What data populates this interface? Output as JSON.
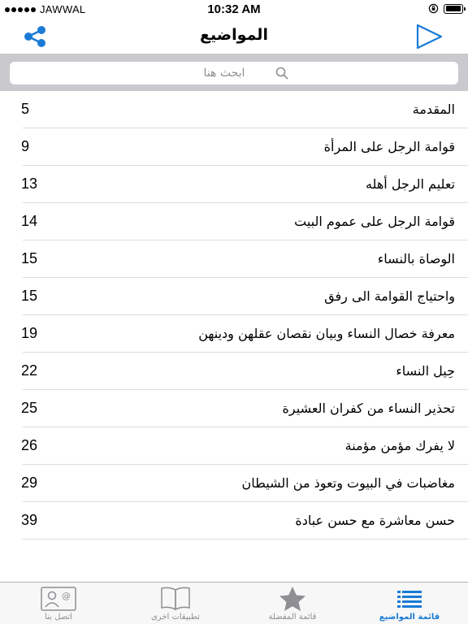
{
  "status_bar": {
    "carrier": "JAWWAL",
    "time": "10:32 AM"
  },
  "nav": {
    "title": "المواضيع"
  },
  "search": {
    "placeholder": "ابحث هنا"
  },
  "topics": [
    {
      "title": "المقدمة",
      "page": "5"
    },
    {
      "title": "قوامة الرجل على المرأة",
      "page": "9"
    },
    {
      "title": "تعليم الرجل أهله",
      "page": "13"
    },
    {
      "title": "قوامة الرجل على عموم البيت",
      "page": "14"
    },
    {
      "title": "الوصاة بالنساء",
      "page": "15"
    },
    {
      "title": "واحتياج القوامة الى رفق",
      "page": "15"
    },
    {
      "title": "معرفة خصال النساء وبيان نقصان عقلهن ودينهن",
      "page": "19"
    },
    {
      "title": "حِيل النساء",
      "page": "22"
    },
    {
      "title": "تحذير النساء من كفران العشيرة",
      "page": "25"
    },
    {
      "title": "لا يفرك مؤمن مؤمنة",
      "page": "26"
    },
    {
      "title": "مغاضبات في البيوت وتعوذ من الشيطان",
      "page": "29"
    },
    {
      "title": "حسن معاشرة مع حسن عبادة",
      "page": "39"
    }
  ],
  "tabs": [
    {
      "label": "اتصل بنا",
      "icon": "contact-card-icon"
    },
    {
      "label": "تطبيقات اخرى",
      "icon": "book-icon"
    },
    {
      "label": "قائمة المفضلة",
      "icon": "star-icon"
    },
    {
      "label": "قائمة المواضيع",
      "icon": "list-icon",
      "active": true
    }
  ],
  "colors": {
    "accent": "#1a7bd6",
    "search_bar_bg": "#c9c9ce",
    "tab_inactive": "#8e8e93"
  }
}
